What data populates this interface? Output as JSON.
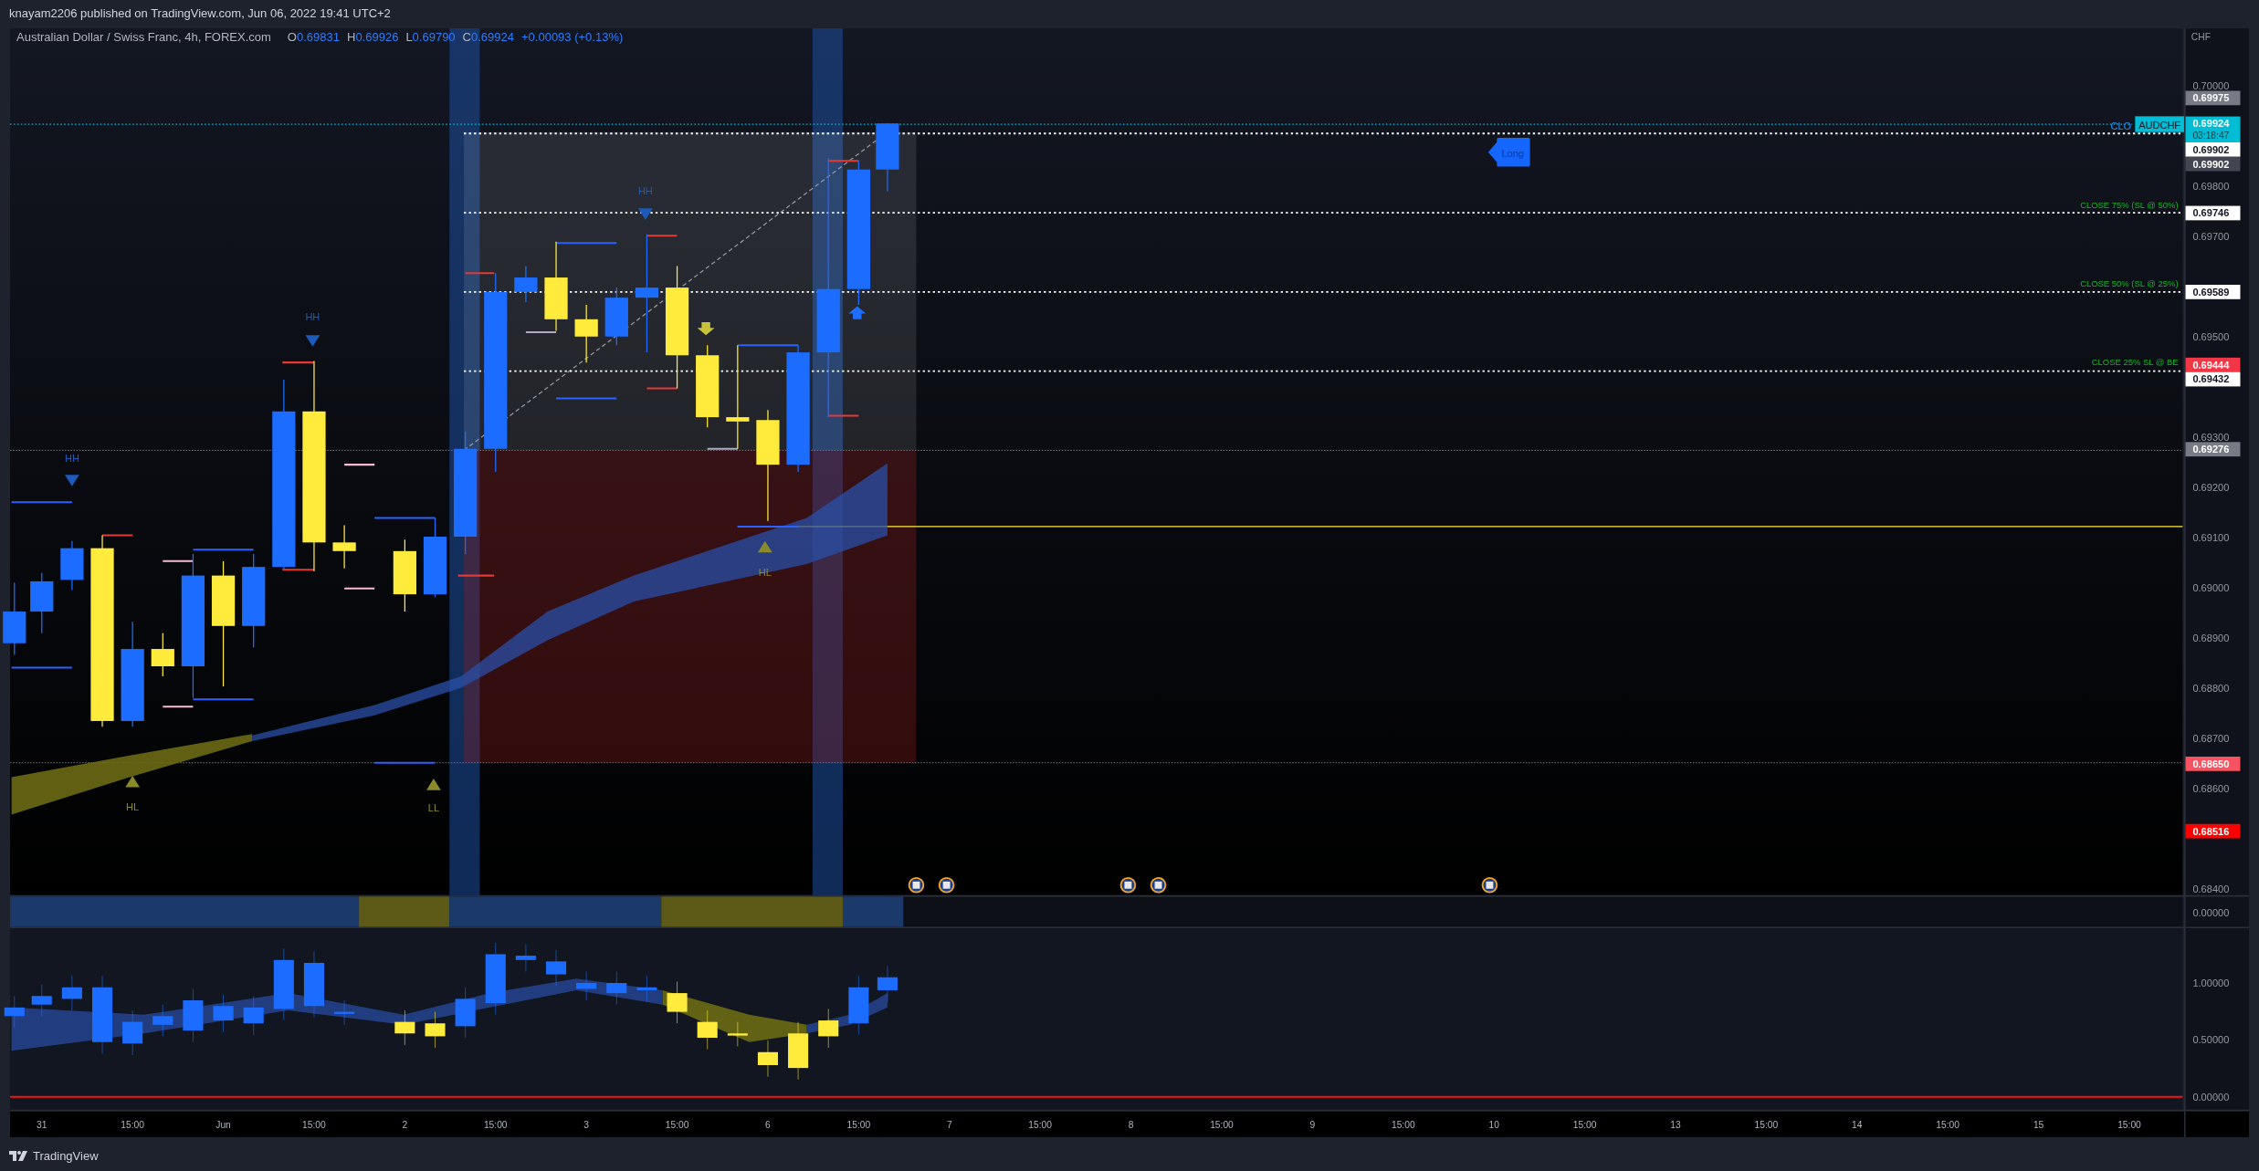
{
  "header": {
    "publisher": "knayam2206 published on TradingView.com, Jun 06, 2022 19:41 UTC+2"
  },
  "legend": {
    "symbol": "Australian Dollar / Swiss Franc, 4h, FOREX.com",
    "values": [
      {
        "key": "O",
        "value": "0.69831"
      },
      {
        "key": "H",
        "value": "0.69926"
      },
      {
        "key": "L",
        "value": "0.69790"
      },
      {
        "key": "C",
        "value": "0.69924"
      }
    ],
    "change": "+0.00093 (+0.13%)"
  },
  "chart": {
    "markers": [
      {
        "kind": "high",
        "label": "HH"
      },
      {
        "kind": "high",
        "label": "HH"
      },
      {
        "kind": "high",
        "label": "HH"
      },
      {
        "kind": "low",
        "label": "HL"
      },
      {
        "kind": "low",
        "label": "HL"
      },
      {
        "kind": "low",
        "label": "LL"
      }
    ],
    "order_labels": [
      "CLOSE 75% (SL @ 50%)",
      "CLOSE 50%  (SL @ 25%)",
      "CLOSE 25% SL @ BE"
    ],
    "close_tag": "CLO",
    "symbol_tag": "AUDCHF",
    "position_tag": "Long"
  },
  "price_axis": {
    "currency": "CHF",
    "ticks": [
      "0.70000",
      "0.69800",
      "0.69700",
      "0.69500",
      "0.69300",
      "0.69200",
      "0.69100",
      "0.69000",
      "0.68900",
      "0.68800",
      "0.68700",
      "0.68600",
      "0.68400"
    ],
    "badges": [
      {
        "value": "0.69975",
        "color": "#787b86"
      },
      {
        "value": "0.69924",
        "countdown": "03:18:47",
        "color": "#00bcd4"
      },
      {
        "value": "0.69902",
        "color": "#ffffff"
      },
      {
        "value": "0.69902",
        "color": "#434651"
      },
      {
        "value": "0.69746",
        "color": "#ffffff"
      },
      {
        "value": "0.69589",
        "color": "#ffffff"
      },
      {
        "value": "0.69444",
        "color": "#f23645"
      },
      {
        "value": "0.69432",
        "color": "#ffffff"
      },
      {
        "value": "0.69276",
        "color": "#787b86"
      },
      {
        "value": "0.68650",
        "color": "#f7525f"
      },
      {
        "value": "0.68516",
        "color": "#ff0000"
      }
    ]
  },
  "strip_axis": {
    "ticks": [
      "0.00000"
    ]
  },
  "oscillator_axis": {
    "ticks": [
      "1.00000",
      "0.50000",
      "0.00000"
    ]
  },
  "time_axis": {
    "labels": [
      "31",
      "15:00",
      "Jun",
      "15:00",
      "2",
      "15:00",
      "3",
      "15:00",
      "6",
      "15:00",
      "7",
      "15:00",
      "8",
      "15:00",
      "9",
      "15:00",
      "10",
      "15:00",
      "13",
      "15:00",
      "14",
      "15:00",
      "15",
      "15:00"
    ]
  },
  "footer": {
    "brand": "TradingView"
  }
}
